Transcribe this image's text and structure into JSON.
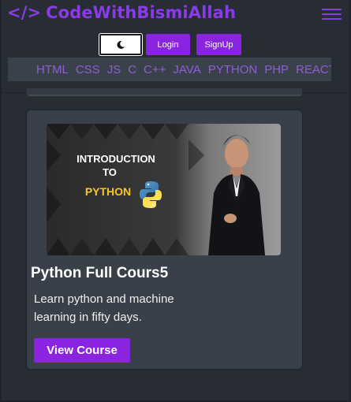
{
  "header": {
    "code_mark": "</>",
    "brand_name": "CodeWithBismiAllah",
    "menu_icon": "hamburger-menu-icon",
    "theme_icon": "crescent-moon-icon",
    "login_label": "Login",
    "signup_label": "SignUp"
  },
  "nav": {
    "items": [
      "HTML",
      "CSS",
      "JS",
      "C",
      "C++",
      "JAVA",
      "PYTHON",
      "PHP",
      "REACT JS"
    ]
  },
  "course": {
    "thumbnail": {
      "line1": "INTRODUCTION",
      "line2": "TO",
      "line3": "PYTHON",
      "icon": "python-logo-icon"
    },
    "title": "Python Full Cours5",
    "description": "Learn python and machine learning in fifty days.",
    "button_label": "View Course"
  },
  "colors": {
    "background": "#272c35",
    "accent": "#8a24e0",
    "brand": "#8a3be8",
    "nav_link": "#8d5ed8",
    "card": "#3a4049"
  }
}
